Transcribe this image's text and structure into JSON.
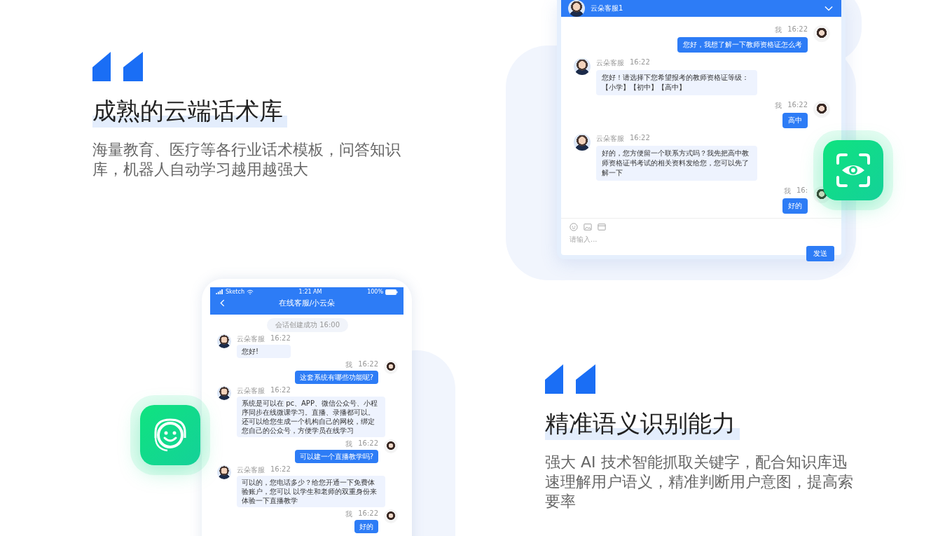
{
  "features": [
    {
      "title": "成熟的云端话术库",
      "description": "海量教育、医疗等各行业话术模板，问答知识库，机器人自动学习越用越强大"
    },
    {
      "title": "精准语义识别能力",
      "description": "强大 AI 技术智能抓取关键字，配合知识库迅速理解用户语义，精准判断用户意图，提高索要率"
    }
  ],
  "desktop_chat": {
    "agent_name": "云朵客服1",
    "messages": [
      {
        "kind": "outgoing",
        "sender": "我",
        "time": "16:22",
        "text": "您好，我想了解一下教师资格证怎么考"
      },
      {
        "kind": "incoming",
        "sender": "云朵客服",
        "time": "16:22",
        "text": "您好！请选择下您希望报考的教师资格证等级：【小学】【初中】【高中】"
      },
      {
        "kind": "outgoing",
        "sender": "我",
        "time": "16:22",
        "text": "高中"
      },
      {
        "kind": "incoming",
        "sender": "云朵客服",
        "time": "16:22",
        "text": "好的，您方便留一个联系方式吗？我先把高中教师资格证书考试的相关资料发给您，您可以先了解一下"
      },
      {
        "kind": "outgoing",
        "sender": "我",
        "time": "16:",
        "text": "好的"
      }
    ],
    "input": {
      "placeholder": "请输入..."
    },
    "send_button": "发送"
  },
  "mobile_chat": {
    "status_bar": {
      "carrier": "Sketch",
      "time": "1:21 AM",
      "battery": "100%"
    },
    "title": "在线客服/小云朵",
    "system_notice": {
      "text": "会话创建成功",
      "time": "16:00"
    },
    "messages": [
      {
        "kind": "incoming",
        "sender": "云朵客服",
        "time": "16:22",
        "text": "您好!"
      },
      {
        "kind": "outgoing",
        "sender": "我",
        "time": "16:22",
        "text": "这套系统有哪些功能呢?"
      },
      {
        "kind": "incoming",
        "sender": "云朵客服",
        "time": "16:22",
        "text": "系统是可以在 pc、APP、微信公众号、小程序同步在线微课学习。直播、录播都可以。还可以给您生成一个机构自己的网校，绑定您自己的公众号，方便学员在线学习"
      },
      {
        "kind": "outgoing",
        "sender": "我",
        "time": "16:22",
        "text": "可以建一个直播教学吗?"
      },
      {
        "kind": "incoming",
        "sender": "云朵客服",
        "time": "16:22",
        "text": "可以的，您电话多少？给您开通一下免费体验账户，您可以 以学生和老师的双重身份来体验一下直播教学"
      },
      {
        "kind": "outgoing",
        "sender": "我",
        "time": "16:22",
        "text": "好的"
      }
    ]
  }
}
